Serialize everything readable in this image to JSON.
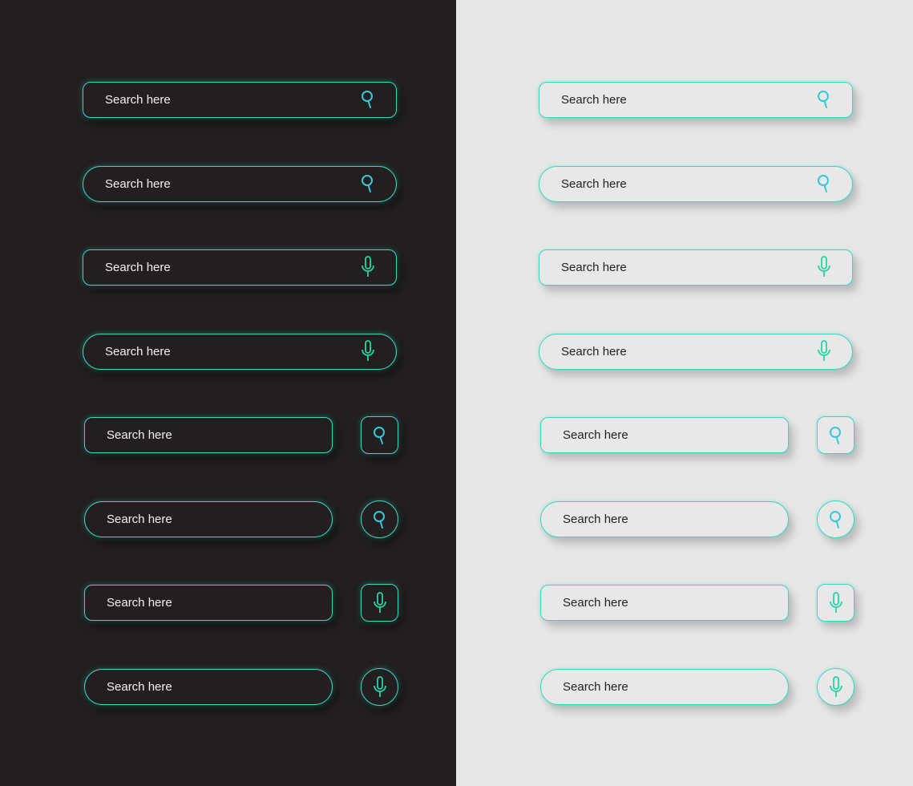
{
  "colors": {
    "dark_bg": "#231f20",
    "light_bg": "#e6e6e6",
    "border": "#3cd6c4",
    "search_icon": "#35c9d9",
    "mic_icon": "#27d3a5"
  },
  "placeholder": "Search here",
  "themes": [
    {
      "name": "dark",
      "bars": [
        {
          "shape": "rounded",
          "layout": "inline",
          "icon": "search-icon",
          "text": "Search here"
        },
        {
          "shape": "pill",
          "layout": "inline",
          "icon": "search-icon",
          "text": "Search here"
        },
        {
          "shape": "rounded",
          "layout": "inline",
          "icon": "mic-icon",
          "text": "Search here"
        },
        {
          "shape": "pill",
          "layout": "inline",
          "icon": "mic-icon",
          "text": "Search here"
        },
        {
          "shape": "rounded",
          "layout": "separate",
          "icon": "search-icon",
          "text": "Search here"
        },
        {
          "shape": "pill",
          "layout": "separate",
          "icon": "search-icon",
          "text": "Search here"
        },
        {
          "shape": "rounded",
          "layout": "separate",
          "icon": "mic-icon",
          "text": "Search here"
        },
        {
          "shape": "pill",
          "layout": "separate",
          "icon": "mic-icon",
          "text": "Search here"
        }
      ]
    },
    {
      "name": "light",
      "bars": [
        {
          "shape": "rounded",
          "layout": "inline",
          "icon": "search-icon",
          "text": "Search here"
        },
        {
          "shape": "pill",
          "layout": "inline",
          "icon": "search-icon",
          "text": "Search here"
        },
        {
          "shape": "rounded",
          "layout": "inline",
          "icon": "mic-icon",
          "text": "Search here"
        },
        {
          "shape": "pill",
          "layout": "inline",
          "icon": "mic-icon",
          "text": "Search here"
        },
        {
          "shape": "rounded",
          "layout": "separate",
          "icon": "search-icon",
          "text": "Search here"
        },
        {
          "shape": "pill",
          "layout": "separate",
          "icon": "search-icon",
          "text": "Search here"
        },
        {
          "shape": "rounded",
          "layout": "separate",
          "icon": "mic-icon",
          "text": "Search here"
        },
        {
          "shape": "pill",
          "layout": "separate",
          "icon": "mic-icon",
          "text": "Search here"
        }
      ]
    }
  ]
}
